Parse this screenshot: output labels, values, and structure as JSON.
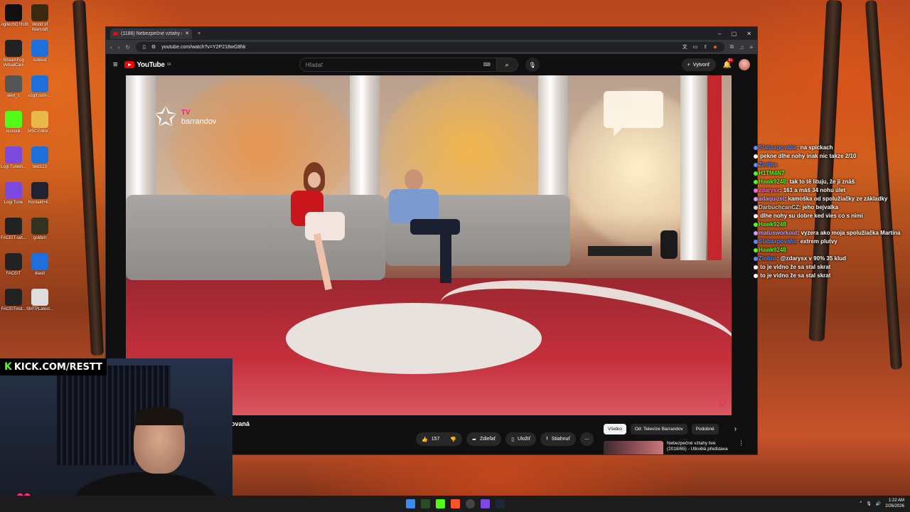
{
  "desktop": {
    "icons": [
      {
        "label": "LogitechG HUB",
        "icon": "logitech-icon",
        "color": "#111"
      },
      {
        "label": "World of Warcraft",
        "icon": "wow-icon",
        "color": "#3b2a10"
      },
      {
        "label": "StreamFog VirtualCam",
        "icon": "streamfog-icon",
        "color": "#222"
      },
      {
        "label": "subtest",
        "icon": "app-icon",
        "color": "#1e6fd9"
      },
      {
        "label": "alert_1",
        "icon": "file-icon",
        "color": "#555"
      },
      {
        "label": "ezgif.com-...",
        "icon": "app-icon",
        "color": "#1e6fd9"
      },
      {
        "label": "kicktalk",
        "icon": "kick-icon",
        "color": "#53fc18"
      },
      {
        "label": "MSCEditor...",
        "icon": "folder-icon",
        "color": "#e8b84a"
      },
      {
        "label": "Logi Tunein...",
        "icon": "logi-tune-icon",
        "color": "#7b48e0"
      },
      {
        "label": "test123",
        "icon": "app-icon",
        "color": "#1e6fd9"
      },
      {
        "label": "Logi Tune",
        "icon": "logi-tune-icon",
        "color": "#7b48e0"
      },
      {
        "label": "Kontakt+4...",
        "icon": "app-icon",
        "color": "#223"
      },
      {
        "label": "FACEIT-set...",
        "icon": "faceit-icon",
        "color": "#222"
      },
      {
        "label": "golden",
        "icon": "app-icon",
        "color": "#332"
      },
      {
        "label": "FACEIT",
        "icon": "faceit-icon",
        "color": "#222"
      },
      {
        "label": "diasit",
        "icon": "app-icon",
        "color": "#1e6fd9"
      },
      {
        "label": "FACEITinst...",
        "icon": "faceit-icon",
        "color": "#222"
      },
      {
        "label": "SMTPLatest...",
        "icon": "app-icon",
        "color": "#ddd"
      }
    ]
  },
  "browser": {
    "tab_title": "(1188) Nebezpečné vztahy (2...",
    "url": "youtube.com/watch?v=Y2P218wG8hk",
    "window_buttons": [
      "–",
      "▢",
      "✕"
    ]
  },
  "youtube": {
    "logo_text": "YouTube",
    "logo_region": "SK",
    "search_placeholder": "Hľadať",
    "create_label": "Vytvoriť",
    "notification_badge": "9+",
    "video_title_fragment": "ovaná",
    "actions": {
      "likes": "157",
      "share": "Zdieľať",
      "save": "Uložiť",
      "download": "Stiahnuť"
    },
    "chips": [
      "Všetko",
      "Od: Televíze Barrandov",
      "Podobné"
    ],
    "recommended": {
      "title_line1": "Nebezpečné vztahy live",
      "title_line2": "(2018/65) - Utkvělá představa"
    },
    "channel_logo": {
      "brand": "TV",
      "name": "barrandov"
    }
  },
  "chat": [
    {
      "user": "Slabaxpovaha",
      "msg": "na spickach",
      "color": "#5b8cff"
    },
    {
      "user": "",
      "msg": "pekne dlhe nohy inak nic takze 2/10",
      "color": "#ffffff"
    },
    {
      "user": "Ziolina",
      "msg": "",
      "color": "#5b8cff"
    },
    {
      "user": "H1TM4N7",
      "msg": "",
      "color": "#53fc18"
    },
    {
      "user": "Hawk9248",
      "msg": "tak to tě lituju, že ji znáš",
      "color": "#53fc18"
    },
    {
      "user": "zdarysx",
      "msg": "161 a máš 34 nohu úlet",
      "color": "#ff6ad5"
    },
    {
      "user": "adaquizel",
      "msg": "kamoška od spolužiačky ze základky",
      "color": "#c5a3ff"
    },
    {
      "user": "DarbuchcanCZ",
      "msg": "jeho bejvalka",
      "color": "#d0d0d0"
    },
    {
      "user": "",
      "msg": "dlhe nohy su dobre ked vies co s nimi",
      "color": "#ffffff"
    },
    {
      "user": "Hawk9248",
      "msg": "",
      "color": "#53fc18"
    },
    {
      "user": "matusworkout",
      "msg": "vyzera ako moja spolužiačka Martina",
      "color": "#c5a3ff"
    },
    {
      "user": "Slabaxpovaha",
      "msg": "extrem plutvy",
      "color": "#5b8cff"
    },
    {
      "user": "Hawk9248",
      "msg": "",
      "color": "#53fc18"
    },
    {
      "user": "Ziolina",
      "msg": "@zdarysx v 90% 35 klud",
      "color": "#5b8cff"
    },
    {
      "user": "",
      "msg": "to je vidno že sa stal skrat",
      "color": "#ffffff"
    },
    {
      "user": "",
      "msg": "to je vidno že sa stal skrat",
      "color": "#ffffff"
    }
  ],
  "stream": {
    "kick_label": "KICK.COM/RESTT"
  },
  "taskbar": {
    "time": "1:22 AM",
    "date": "2/26/2026"
  }
}
